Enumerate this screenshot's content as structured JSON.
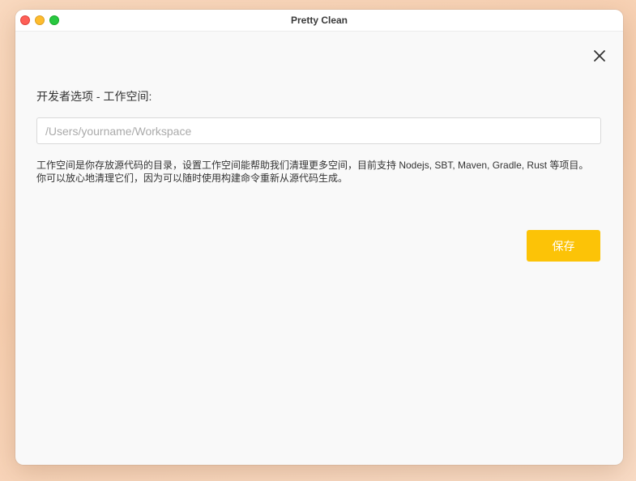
{
  "window": {
    "title": "Pretty Clean"
  },
  "dialog": {
    "section_label": "开发者选项 - 工作空间:",
    "workspace_input": {
      "value": "",
      "placeholder": "/Users/yourname/Workspace"
    },
    "description_lines": [
      "工作空间是你存放源代码的目录，设置工作空间能帮助我们清理更多空间，目前支持 Nodejs, SBT, Maven, Gradle, Rust 等项目。",
      "你可以放心地清理它们，因为可以随时使用构建命令重新从源代码生成。"
    ],
    "save_label": "保存"
  },
  "icons": {
    "close": "close-icon"
  },
  "colors": {
    "accent": "#fcc307",
    "traffic_close": "#fe5f57",
    "traffic_minimize": "#febc2e",
    "traffic_maximize": "#28c840"
  }
}
